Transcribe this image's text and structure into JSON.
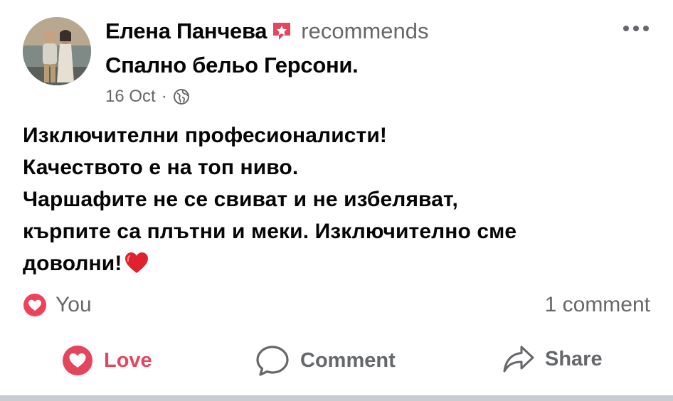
{
  "post": {
    "author": "Елена Панчева",
    "recommends_text": "recommends",
    "page_name": "Спално бельо Герсони.",
    "date": "16 Oct",
    "separator": "·",
    "lines": [
      "Изключителни професионалисти!",
      "Качеството е на топ ниво.",
      "Чаршафите не се свиват и не избеляват,",
      "кърпите са плътни и меки. Изключително сме",
      "доволни!"
    ]
  },
  "reactions": {
    "icon": "love-reaction-icon",
    "label": "You"
  },
  "comments_count": "1 comment",
  "actions": {
    "love": "Love",
    "comment": "Comment",
    "share": "Share"
  },
  "colors": {
    "love": "#e4465d",
    "secondary_text": "#65676b",
    "primary_text": "#050505"
  }
}
